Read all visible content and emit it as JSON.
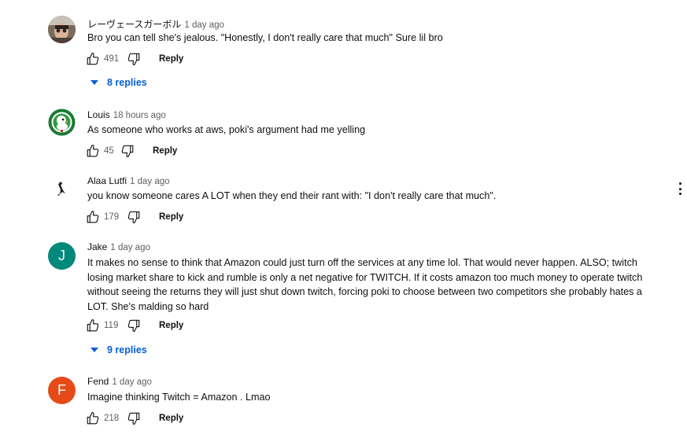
{
  "comments": [
    {
      "author": "レーヴェースガーボル",
      "time": "1 day ago",
      "text": "Bro you can tell she's jealous. \"Honestly, I don't really care that much\" Sure lil bro",
      "likes": "491",
      "reply_label": "Reply",
      "replies_label": "8 replies",
      "avatar_icon": "photo-avatar"
    },
    {
      "author": "Louis",
      "time": "18 hours ago",
      "text": "As someone who works at aws, poki's argument had me yelling",
      "likes": "45",
      "reply_label": "Reply",
      "avatar_icon": "duck-avatar"
    },
    {
      "author": "Alaa Lutfi",
      "time": "1 day ago",
      "text": "you know someone cares A LOT when they end their rant with: \"I don't really care that much\".",
      "likes": "179",
      "reply_label": "Reply",
      "avatar_icon": "bird-avatar"
    },
    {
      "author": "Jake",
      "time": "1 day ago",
      "text": "It makes no sense to think that Amazon could just turn off the services at any time lol. That would never happen. ALSO; twitch losing market share to kick and rumble is only a net negative for TWITCH. If it costs amazon too much money to operate twitch without seeing the returns they will just shut down twitch, forcing poki to choose between two competitors she probably hates a LOT. She's malding so hard",
      "likes": "119",
      "reply_label": "Reply",
      "replies_label": "9 replies",
      "avatar_letter": "J",
      "avatar_color": "#00897b"
    },
    {
      "author": "Fend",
      "time": "1 day ago",
      "text": "Imagine thinking Twitch = Amazon . Lmao",
      "likes": "218",
      "reply_label": "Reply",
      "avatar_letter": "F",
      "avatar_color": "#e64a19"
    }
  ],
  "icons": {
    "like": "thumb-up-icon",
    "dislike": "thumb-down-icon",
    "expand": "caret-down-icon",
    "more": "more-vert-icon"
  }
}
